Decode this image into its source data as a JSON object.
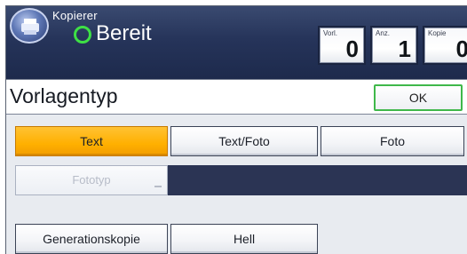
{
  "header": {
    "app_name": "Kopierer",
    "status": "Bereit",
    "counters": {
      "originals": {
        "label": "Vorl.",
        "value": "0"
      },
      "quantity": {
        "label": "Anz.",
        "value": "1"
      },
      "copies": {
        "label": "Kopie",
        "value": "0"
      }
    }
  },
  "title_bar": {
    "title": "Vorlagentyp",
    "ok_label": "OK"
  },
  "original_type": {
    "options": [
      "Text",
      "Text/Foto",
      "Foto"
    ],
    "selected": "Text"
  },
  "photo_type": {
    "label": "Fototyp"
  },
  "extra_options": {
    "generation_copy": "Generationskopie",
    "light": "Hell"
  },
  "colors": {
    "selected": "#ffb000",
    "header_bg": "#26345a",
    "ok_border": "#3fb84a",
    "status_ring": "#3ee045"
  }
}
